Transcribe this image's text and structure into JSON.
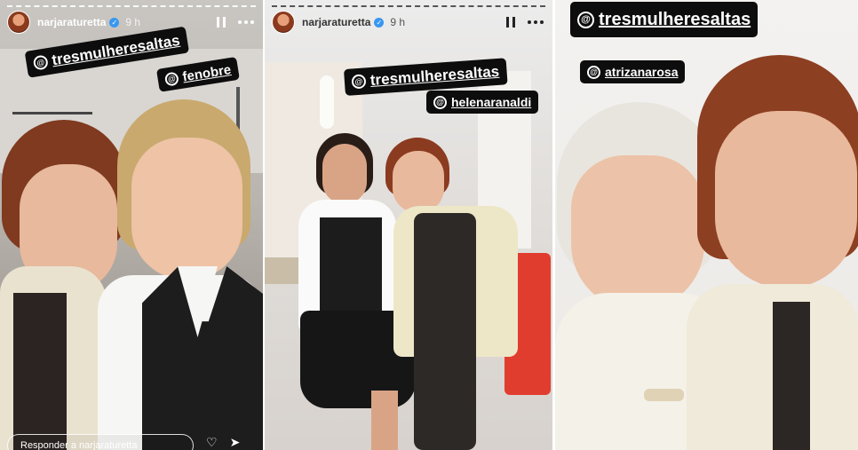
{
  "story1": {
    "username": "narjaraturetta",
    "time": "9 h",
    "tags": [
      "tresmulheresaltas",
      "fenobre"
    ],
    "reply_placeholder": "Responder a narjaraturetta",
    "icons": [
      "heart-icon",
      "send-icon"
    ]
  },
  "story2": {
    "username": "narjaraturetta",
    "time": "9 h",
    "tags": [
      "tresmulheresaltas",
      "helenaranaldi"
    ]
  },
  "story3": {
    "tags": [
      "tresmulheresaltas",
      "atrizanarosa"
    ]
  },
  "colors": {
    "tag_bg": "#0d0d0d",
    "tag_text": "#ffffff",
    "verified": "#3897f0"
  }
}
